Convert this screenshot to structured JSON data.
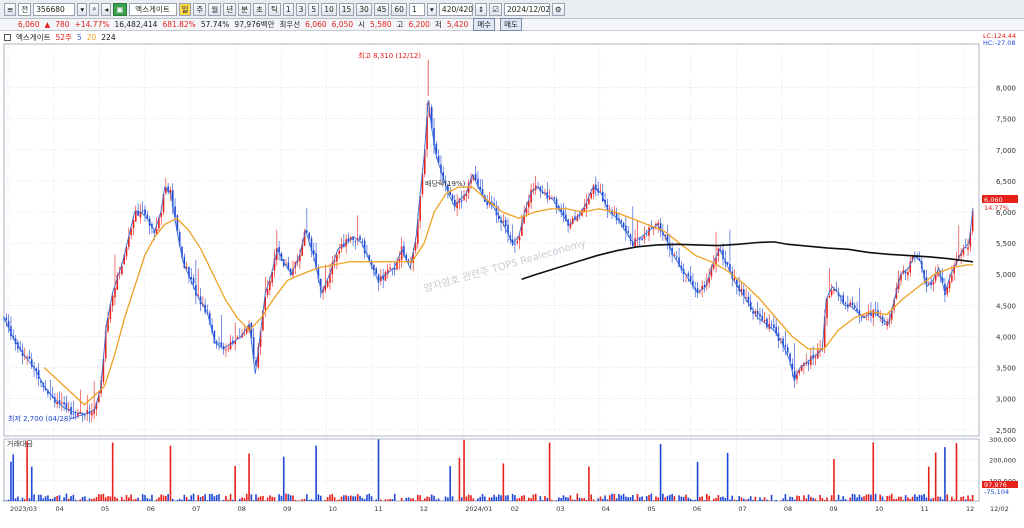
{
  "toolbar": {
    "menu_icon": "≡",
    "market_label": "전",
    "code": "356680",
    "stock_name": "엑스게이트",
    "period_buttons": [
      "주",
      "월",
      "년",
      "분",
      "초",
      "틱"
    ],
    "interval_buttons": [
      "1",
      "3",
      "5",
      "10",
      "15",
      "30",
      "45",
      "60"
    ],
    "unit_value": "1",
    "count_value": "420/420",
    "date_value": "2024/12/02"
  },
  "info": {
    "price": "6,060",
    "change_arrow": "▲",
    "change": "780",
    "change_pct": "+14.77%",
    "volume": "16,482,414",
    "volume_ratio": "681.82%",
    "ratio2": "57.74%",
    "amount": "97,976백만",
    "priority_label": "최우선",
    "bid1": "6,060",
    "bid2": "6,050",
    "open_label": "시",
    "open": "5,580",
    "high_label": "고",
    "high": "6,200",
    "low_label": "저",
    "low": "5,420",
    "buy_button": "매수",
    "sell_button": "매도"
  },
  "legend": {
    "name": "엑스게이트",
    "ma_label": "52주",
    "ma1": "5",
    "ma2": "20",
    "ma3": "224"
  },
  "volume_panel": {
    "title": "거래대금"
  },
  "watermark": "양자암호 관련주 TOP5 Realeconomy",
  "colors": {
    "up": "#e8201a",
    "down": "#1f48d6",
    "ma5": "#3a6fd8",
    "ma20": "#f0a020",
    "ma224": "#111111"
  },
  "chart_data": {
    "type": "candlestick",
    "title": "",
    "y_ticks": [
      "8,000",
      "7,500",
      "7,000",
      "6,500",
      "6,000",
      "5,500",
      "5,000",
      "4,500",
      "4,000",
      "3,500",
      "3,000",
      "2,500"
    ],
    "ylim": [
      2400,
      8700
    ],
    "x_ticks": [
      "2023/03",
      "04",
      "05",
      "06",
      "07",
      "08",
      "09",
      "10",
      "11",
      "12",
      "2024/01",
      "02",
      "03",
      "04",
      "05",
      "06",
      "07",
      "08",
      "09",
      "10",
      "11",
      "12",
      "12/02"
    ],
    "annotations": {
      "high": "최고 8,310 (12/12)",
      "low": "최저 2,700 (04/28)",
      "mid": "배당락(19%)",
      "current_price": "6,060",
      "current_pct": "14.77%",
      "lc": "LC:124.44",
      "hc": "HC:-27.08"
    },
    "price_path": [
      [
        0,
        4300
      ],
      [
        10,
        3950
      ],
      [
        20,
        3700
      ],
      [
        30,
        3500
      ],
      [
        40,
        3200
      ],
      [
        50,
        3000
      ],
      [
        60,
        2850
      ],
      [
        70,
        2780
      ],
      [
        80,
        2750
      ],
      [
        90,
        2820
      ],
      [
        96,
        3150
      ],
      [
        102,
        4200
      ],
      [
        108,
        4700
      ],
      [
        114,
        5000
      ],
      [
        118,
        5200
      ],
      [
        124,
        5600
      ],
      [
        130,
        6000
      ],
      [
        136,
        6000
      ],
      [
        142,
        5900
      ],
      [
        150,
        5700
      ],
      [
        156,
        6000
      ],
      [
        160,
        6400
      ],
      [
        166,
        6300
      ],
      [
        172,
        5700
      ],
      [
        178,
        5200
      ],
      [
        186,
        4900
      ],
      [
        194,
        4600
      ],
      [
        202,
        4400
      ],
      [
        210,
        3900
      ],
      [
        218,
        3800
      ],
      [
        228,
        3900
      ],
      [
        236,
        4000
      ],
      [
        244,
        4200
      ],
      [
        250,
        3400
      ],
      [
        254,
        3900
      ],
      [
        260,
        4700
      ],
      [
        266,
        5000
      ],
      [
        272,
        5400
      ],
      [
        278,
        5200
      ],
      [
        286,
        5000
      ],
      [
        294,
        5300
      ],
      [
        300,
        5700
      ],
      [
        308,
        5300
      ],
      [
        316,
        4700
      ],
      [
        324,
        5000
      ],
      [
        332,
        5400
      ],
      [
        340,
        5500
      ],
      [
        348,
        5600
      ],
      [
        356,
        5500
      ],
      [
        364,
        5200
      ],
      [
        372,
        4900
      ],
      [
        380,
        5000
      ],
      [
        388,
        5100
      ],
      [
        396,
        5400
      ],
      [
        404,
        5100
      ],
      [
        410,
        5600
      ],
      [
        414,
        6300
      ],
      [
        418,
        6900
      ],
      [
        422,
        7800
      ],
      [
        426,
        7300
      ],
      [
        430,
        6900
      ],
      [
        436,
        6600
      ],
      [
        442,
        6300
      ],
      [
        448,
        6100
      ],
      [
        454,
        6200
      ],
      [
        460,
        6300
      ],
      [
        466,
        6600
      ],
      [
        472,
        6400
      ],
      [
        478,
        6200
      ],
      [
        486,
        6100
      ],
      [
        494,
        5900
      ],
      [
        500,
        5700
      ],
      [
        506,
        5500
      ],
      [
        512,
        5600
      ],
      [
        518,
        6000
      ],
      [
        524,
        6300
      ],
      [
        530,
        6400
      ],
      [
        538,
        6300
      ],
      [
        546,
        6200
      ],
      [
        554,
        6000
      ],
      [
        562,
        5800
      ],
      [
        570,
        5900
      ],
      [
        578,
        6100
      ],
      [
        586,
        6400
      ],
      [
        594,
        6300
      ],
      [
        602,
        6000
      ],
      [
        610,
        5900
      ],
      [
        618,
        5700
      ],
      [
        626,
        5500
      ],
      [
        634,
        5600
      ],
      [
        642,
        5700
      ],
      [
        650,
        5800
      ],
      [
        658,
        5600
      ],
      [
        666,
        5300
      ],
      [
        674,
        5100
      ],
      [
        682,
        4900
      ],
      [
        690,
        4700
      ],
      [
        698,
        4800
      ],
      [
        706,
        5200
      ],
      [
        712,
        5400
      ],
      [
        718,
        5200
      ],
      [
        726,
        4900
      ],
      [
        734,
        4700
      ],
      [
        742,
        4500
      ],
      [
        750,
        4300
      ],
      [
        758,
        4200
      ],
      [
        766,
        4100
      ],
      [
        774,
        3900
      ],
      [
        782,
        3600
      ],
      [
        786,
        3300
      ],
      [
        792,
        3500
      ],
      [
        800,
        3600
      ],
      [
        808,
        3700
      ],
      [
        814,
        3800
      ],
      [
        818,
        4600
      ],
      [
        824,
        4800
      ],
      [
        830,
        4700
      ],
      [
        836,
        4500
      ],
      [
        842,
        4500
      ],
      [
        848,
        4400
      ],
      [
        856,
        4300
      ],
      [
        864,
        4400
      ],
      [
        872,
        4300
      ],
      [
        880,
        4200
      ],
      [
        886,
        4600
      ],
      [
        892,
        5000
      ],
      [
        900,
        5100
      ],
      [
        906,
        5300
      ],
      [
        912,
        5200
      ],
      [
        918,
        4800
      ],
      [
        924,
        4900
      ],
      [
        930,
        5100
      ],
      [
        936,
        4700
      ],
      [
        942,
        5000
      ],
      [
        948,
        5200
      ],
      [
        954,
        5400
      ],
      [
        960,
        5500
      ],
      [
        964,
        6060
      ]
    ],
    "ma20": [
      [
        40,
        3500
      ],
      [
        60,
        3200
      ],
      [
        80,
        2900
      ],
      [
        100,
        3200
      ],
      [
        110,
        3700
      ],
      [
        120,
        4300
      ],
      [
        130,
        4800
      ],
      [
        140,
        5300
      ],
      [
        150,
        5600
      ],
      [
        160,
        5800
      ],
      [
        172,
        5900
      ],
      [
        184,
        5700
      ],
      [
        196,
        5400
      ],
      [
        208,
        5000
      ],
      [
        220,
        4600
      ],
      [
        232,
        4300
      ],
      [
        244,
        4100
      ],
      [
        256,
        4300
      ],
      [
        268,
        4600
      ],
      [
        282,
        4900
      ],
      [
        296,
        5000
      ],
      [
        312,
        5100
      ],
      [
        328,
        5150
      ],
      [
        344,
        5200
      ],
      [
        360,
        5200
      ],
      [
        376,
        5200
      ],
      [
        392,
        5200
      ],
      [
        406,
        5200
      ],
      [
        418,
        5500
      ],
      [
        428,
        6000
      ],
      [
        440,
        6300
      ],
      [
        452,
        6400
      ],
      [
        466,
        6400
      ],
      [
        480,
        6200
      ],
      [
        496,
        6000
      ],
      [
        512,
        5900
      ],
      [
        528,
        6000
      ],
      [
        544,
        6050
      ],
      [
        560,
        6050
      ],
      [
        576,
        6000
      ],
      [
        592,
        6050
      ],
      [
        608,
        6000
      ],
      [
        624,
        5900
      ],
      [
        640,
        5800
      ],
      [
        656,
        5700
      ],
      [
        672,
        5500
      ],
      [
        688,
        5300
      ],
      [
        704,
        5200
      ],
      [
        720,
        5050
      ],
      [
        736,
        4850
      ],
      [
        752,
        4600
      ],
      [
        768,
        4300
      ],
      [
        784,
        4000
      ],
      [
        800,
        3800
      ],
      [
        816,
        3800
      ],
      [
        830,
        4100
      ],
      [
        846,
        4300
      ],
      [
        862,
        4400
      ],
      [
        878,
        4350
      ],
      [
        894,
        4600
      ],
      [
        910,
        4800
      ],
      [
        926,
        5000
      ],
      [
        942,
        5100
      ],
      [
        958,
        5150
      ],
      [
        964,
        5150
      ]
    ],
    "ma224": [
      [
        515,
        4920
      ],
      [
        530,
        5000
      ],
      [
        550,
        5100
      ],
      [
        570,
        5200
      ],
      [
        590,
        5300
      ],
      [
        610,
        5380
      ],
      [
        630,
        5440
      ],
      [
        650,
        5470
      ],
      [
        670,
        5480
      ],
      [
        690,
        5470
      ],
      [
        710,
        5460
      ],
      [
        730,
        5480
      ],
      [
        750,
        5510
      ],
      [
        766,
        5520
      ],
      [
        780,
        5480
      ],
      [
        800,
        5450
      ],
      [
        820,
        5420
      ],
      [
        840,
        5400
      ],
      [
        860,
        5350
      ],
      [
        880,
        5320
      ],
      [
        900,
        5300
      ],
      [
        920,
        5280
      ],
      [
        940,
        5250
      ],
      [
        964,
        5200
      ]
    ],
    "volume_ylim": [
      0,
      300000
    ],
    "volume_ticks": [
      "300,000",
      "200,000",
      "100,000"
    ],
    "volume_readout": "97,976",
    "volume_readout2": "-75,104"
  }
}
